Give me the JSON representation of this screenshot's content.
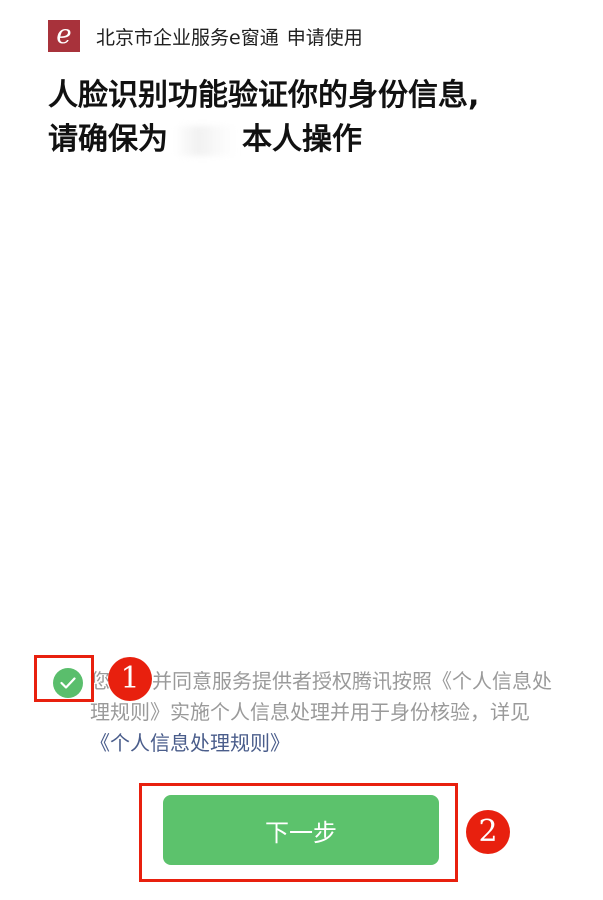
{
  "header": {
    "logo_letter": "e",
    "app_name": "北京市企业服务e窗通",
    "action_text": "申请使用"
  },
  "title": {
    "line1": "人脸识别功能验证你的身份信息,",
    "line2_prefix": "请确保为",
    "line2_suffix": "本人操作"
  },
  "agreement": {
    "checked": true,
    "text_part1": "您",
    "text_part2": "并同意服务提供者授权腾讯按照《个人信息处理规则》实施个人信息处理并用于身份核验，详见",
    "link_text": "《个人信息处理规则》"
  },
  "next_button_label": "下一步",
  "annotations": {
    "badge_1": "1",
    "badge_2": "2"
  },
  "colors": {
    "logo_bg": "#a8323b",
    "accent_green": "#5cc26c",
    "annotation_red": "#e8200e",
    "link_blue": "#4a5d8b"
  }
}
